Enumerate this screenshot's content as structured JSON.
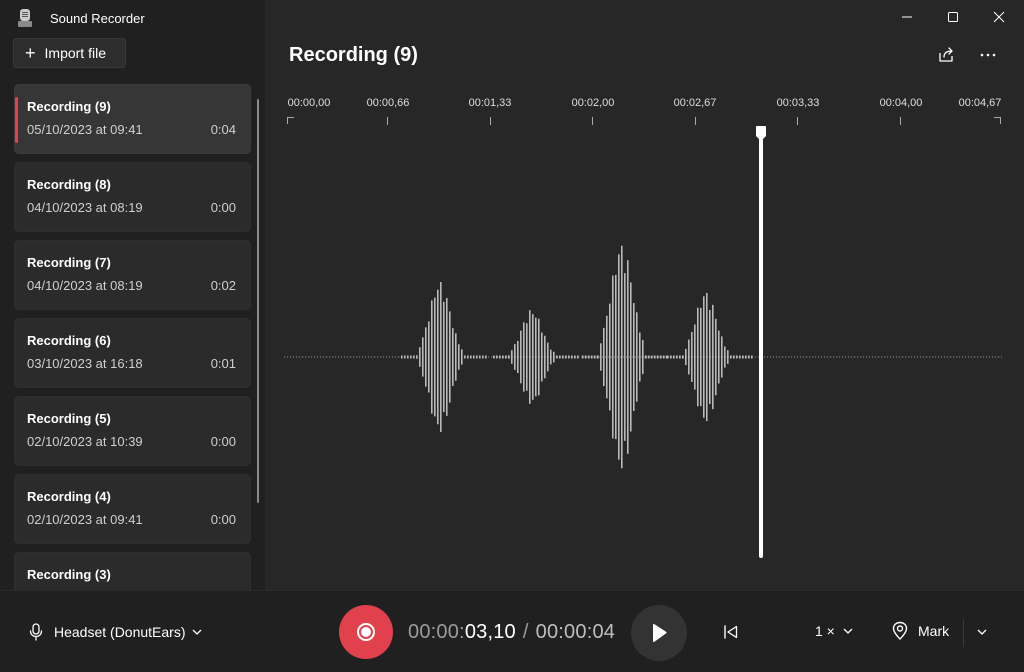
{
  "app": {
    "title": "Sound Recorder",
    "import_label": "Import file"
  },
  "recordings": [
    {
      "name": "Recording (9)",
      "date": "05/10/2023 at 09:41",
      "duration": "0:04",
      "selected": true
    },
    {
      "name": "Recording (8)",
      "date": "04/10/2023 at 08:19",
      "duration": "0:00"
    },
    {
      "name": "Recording (7)",
      "date": "04/10/2023 at 08:19",
      "duration": "0:02"
    },
    {
      "name": "Recording (6)",
      "date": "03/10/2023 at 16:18",
      "duration": "0:01"
    },
    {
      "name": "Recording (5)",
      "date": "02/10/2023 at 10:39",
      "duration": "0:00"
    },
    {
      "name": "Recording (4)",
      "date": "02/10/2023 at 09:41",
      "duration": "0:00"
    },
    {
      "name": "Recording (3)",
      "date": "",
      "duration": ""
    }
  ],
  "main": {
    "title": "Recording (9)",
    "ruler_labels": [
      "00:00,00",
      "00:00,66",
      "00:01,33",
      "00:02,00",
      "00:02,67",
      "00:03,33",
      "00:04,00",
      "00:04,67"
    ],
    "playhead_time": "00:03,10",
    "duration_seconds": 4.67
  },
  "player": {
    "microphone": "Headset (DonutEars)",
    "time_dim": "00:00:",
    "time_current": "03,10",
    "time_separator": "/",
    "time_total": "00:00:04",
    "speed": "1 ×",
    "mark_label": "Mark"
  },
  "colors": {
    "accent": "#e0414d",
    "selected_bar": "#f03a4c"
  },
  "icons": {
    "window": [
      "minimize-icon",
      "maximize-icon",
      "close-icon"
    ],
    "header": [
      "share-icon",
      "more-icon"
    ],
    "bottom": [
      "microphone-icon",
      "chevron-down-icon",
      "record-icon",
      "play-icon",
      "skip-back-icon",
      "pin-icon"
    ]
  }
}
